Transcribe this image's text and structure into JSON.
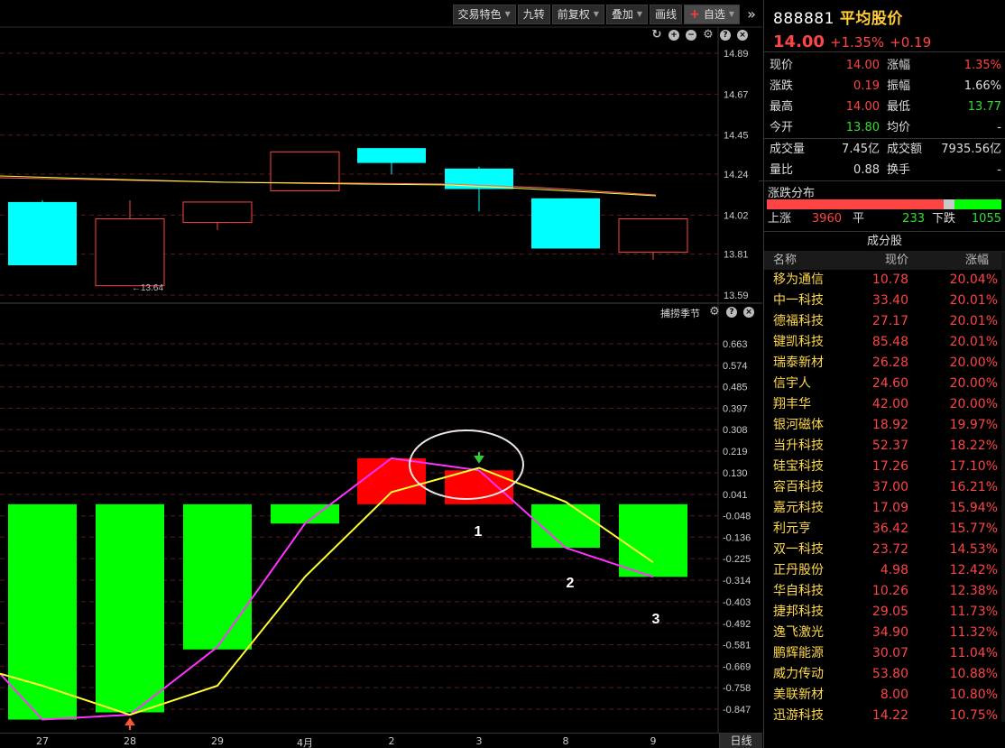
{
  "toolbar": {
    "items": [
      "交易特色",
      "九转",
      "前复权",
      "叠加",
      "画线",
      "自选"
    ],
    "more": "»"
  },
  "main_chart": {
    "price_ticks": [
      "14.89",
      "14.67",
      "14.45",
      "14.24",
      "14.02",
      "13.81",
      "13.59"
    ],
    "low_annotation": "←13.64",
    "candles": [
      {
        "open": 14.09,
        "close": 13.75,
        "high": 14.1,
        "low": 13.75,
        "color": "cyan"
      },
      {
        "open": 13.64,
        "close": 14.0,
        "high": 14.1,
        "low": 13.64,
        "color": "red"
      },
      {
        "open": 13.98,
        "close": 14.09,
        "high": 14.09,
        "low": 13.94,
        "color": "red"
      },
      {
        "open": 14.15,
        "close": 14.36,
        "high": 14.36,
        "low": 14.15,
        "color": "red"
      },
      {
        "open": 14.38,
        "close": 14.3,
        "high": 14.38,
        "low": 14.24,
        "color": "cyan"
      },
      {
        "open": 14.27,
        "close": 14.16,
        "high": 14.28,
        "low": 14.04,
        "color": "cyan"
      },
      {
        "open": 14.11,
        "close": 13.84,
        "high": 14.11,
        "low": 13.84,
        "color": "cyan"
      },
      {
        "open": 13.82,
        "close": 14.0,
        "high": 14.0,
        "low": 13.78,
        "color": "red"
      }
    ]
  },
  "indicator": {
    "name": "捕捞季节",
    "ticks": [
      "0.663",
      "0.574",
      "0.485",
      "0.397",
      "0.308",
      "0.219",
      "0.130",
      "0.041",
      "-0.048",
      "-0.136",
      "-0.225",
      "-0.314",
      "-0.403",
      "-0.492",
      "-0.581",
      "-0.669",
      "-0.758",
      "-0.847"
    ],
    "bars": [
      -0.89,
      -0.86,
      -0.6,
      -0.08,
      0.19,
      0.14,
      -0.18,
      -0.3
    ],
    "magenta": [
      -0.7,
      -0.89,
      -0.87,
      -0.59,
      -0.08,
      0.19,
      0.14,
      -0.18,
      -0.3
    ],
    "yellow": [
      -0.7,
      -0.75,
      -0.87,
      -0.75,
      -0.3,
      0.05,
      0.15,
      0.01,
      -0.24
    ],
    "annotations": [
      "1",
      "2",
      "3"
    ]
  },
  "dates": [
    "27",
    "28",
    "29",
    "4月",
    "2",
    "3",
    "8",
    "9"
  ],
  "period_button": "日线",
  "stock": {
    "code": "888881",
    "name": "平均股价",
    "price": "14.00",
    "change_pct": "+1.35%",
    "change": "+0.19"
  },
  "quote": {
    "rows": [
      {
        "k1": "现价",
        "v1": "14.00",
        "c1": "red",
        "k2": "涨幅",
        "v2": "1.35%",
        "c2": "red"
      },
      {
        "k1": "涨跌",
        "v1": "0.19",
        "c1": "red",
        "k2": "振幅",
        "v2": "1.66%",
        "c2": "white"
      },
      {
        "k1": "最高",
        "v1": "14.00",
        "c1": "red",
        "k2": "最低",
        "v2": "13.77",
        "c2": "green"
      },
      {
        "k1": "今开",
        "v1": "13.80",
        "c1": "green",
        "k2": "均价",
        "v2": "-",
        "c2": "white"
      }
    ],
    "rows2": [
      {
        "k1": "成交量",
        "v1": "7.45亿",
        "c1": "white",
        "k2": "成交额",
        "v2": "7935.56亿",
        "c2": "white"
      },
      {
        "k1": "量比",
        "v1": "0.88",
        "c1": "white",
        "k2": "换手",
        "v2": "-",
        "c2": "white"
      }
    ]
  },
  "distribution": {
    "title": "涨跌分布",
    "up_label": "上涨",
    "up": "3960",
    "flat_label": "平",
    "flat": "233",
    "down_label": "下跌",
    "down": "1055"
  },
  "constituents": {
    "title": "成分股",
    "headers": [
      "名称",
      "现价",
      "涨幅"
    ],
    "rows": [
      [
        "移为通信",
        "10.78",
        "20.04%"
      ],
      [
        "中一科技",
        "33.40",
        "20.01%"
      ],
      [
        "德福科技",
        "27.17",
        "20.01%"
      ],
      [
        "键凯科技",
        "85.48",
        "20.01%"
      ],
      [
        "瑞泰新材",
        "26.28",
        "20.00%"
      ],
      [
        "信宇人",
        "24.60",
        "20.00%"
      ],
      [
        "翔丰华",
        "42.00",
        "20.00%"
      ],
      [
        "银河磁体",
        "18.92",
        "19.97%"
      ],
      [
        "当升科技",
        "52.37",
        "18.22%"
      ],
      [
        "硅宝科技",
        "17.26",
        "17.10%"
      ],
      [
        "容百科技",
        "37.00",
        "16.21%"
      ],
      [
        "嘉元科技",
        "17.09",
        "15.94%"
      ],
      [
        "利元亨",
        "36.42",
        "15.77%"
      ],
      [
        "双一科技",
        "23.72",
        "14.53%"
      ],
      [
        "正丹股份",
        "4.98",
        "12.42%"
      ],
      [
        "华自科技",
        "10.26",
        "12.38%"
      ],
      [
        "捷邦科技",
        "29.05",
        "11.73%"
      ],
      [
        "逸飞激光",
        "34.90",
        "11.32%"
      ],
      [
        "鹏辉能源",
        "30.07",
        "11.04%"
      ],
      [
        "威力传动",
        "53.80",
        "10.88%"
      ],
      [
        "美联新材",
        "8.00",
        "10.80%"
      ],
      [
        "迅游科技",
        "14.22",
        "10.75%"
      ]
    ]
  },
  "colors": {
    "up": "#ff4444",
    "down": "#00ffff",
    "ind_up": "#ff0000",
    "ind_down": "#00ff00",
    "magenta": "#ff33ff",
    "yellow": "#ffff33",
    "label_yellow": "#ffd94a"
  }
}
